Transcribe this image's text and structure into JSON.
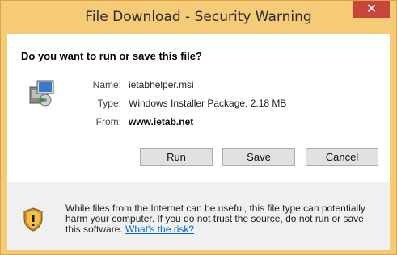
{
  "window": {
    "title": "File Download - Security Warning",
    "close_glyph": "✕"
  },
  "dialog": {
    "question": "Do you want to run or save this file?",
    "fields": {
      "name_label": "Name:",
      "name_value": "ietabhelper.msi",
      "type_label": "Type:",
      "type_value": "Windows Installer Package, 2.18 MB",
      "from_label": "From:",
      "from_value": "www.ietab.net"
    },
    "buttons": {
      "run": "Run",
      "save": "Save",
      "cancel": "Cancel"
    },
    "warning": {
      "text": "While files from the Internet can be useful, this file type can potentially harm your computer. If you do not trust the source, do not run or save this software.",
      "link": "What's the risk?"
    }
  },
  "icons": {
    "file": "installer-package-icon",
    "warning": "security-shield-icon"
  },
  "colors": {
    "titlebar": "#f6cb78",
    "close": "#c7453a",
    "link": "#0066cc"
  }
}
